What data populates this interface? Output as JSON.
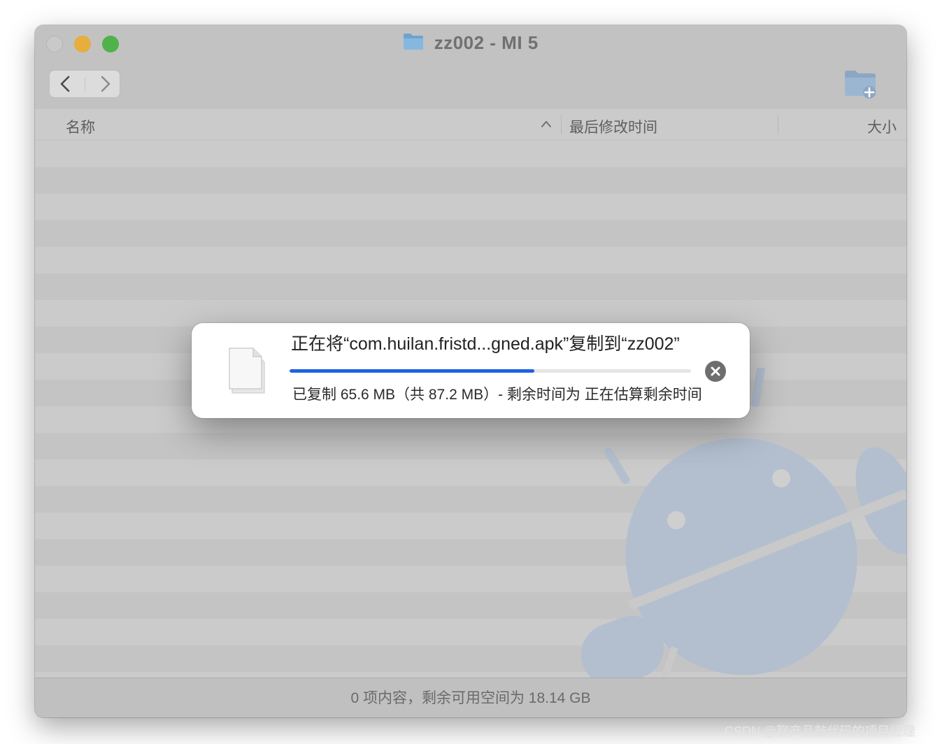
{
  "window": {
    "title": "zz002 - MI 5",
    "title_folder_icon": "folder-icon",
    "new_folder_icon": "folder-badge-plus-icon",
    "back_icon": "chevron-left-icon",
    "forward_icon": "chevron-right-icon"
  },
  "columns": {
    "name": "名称",
    "date_modified": "最后修改时间",
    "size": "大小",
    "sort_icon": "chevron-up-icon"
  },
  "status": {
    "text": "0 项内容，剩余可用空间为 18.14 GB"
  },
  "copy_dialog": {
    "title": "正在将“com.huilan.fristd...gned.apk”复制到“zz002”",
    "status": "已复制 65.6 MB（共 87.2 MB）- 剩余时间为 正在估算剩余时间",
    "progress": 0.61,
    "progress_color": "#1f62e0",
    "file_icon": "document-icon",
    "cancel_icon": "close-circle-icon"
  },
  "background_icon": "android-robot-icon",
  "watermark": "CSDN @聊产品敲代码的项目经理"
}
